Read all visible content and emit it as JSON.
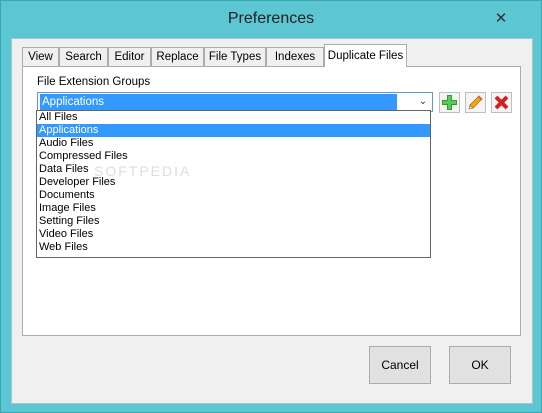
{
  "window": {
    "title": "Preferences",
    "close_glyph": "✕"
  },
  "tabs": [
    {
      "label": "View"
    },
    {
      "label": "Search"
    },
    {
      "label": "Editor"
    },
    {
      "label": "Replace"
    },
    {
      "label": "File Types"
    },
    {
      "label": "Indexes"
    },
    {
      "label": "Duplicate Files",
      "active": true
    }
  ],
  "panel": {
    "group_label": "File Extension Groups",
    "selected_group": "Applications",
    "dropdown_arrow": "⌄",
    "buttons": {
      "add_icon": "plus-icon",
      "edit_icon": "pencil-icon",
      "delete_icon": "delete-x-icon"
    },
    "colors": {
      "add": "#2e9e2e",
      "edit": "#f2a51a",
      "delete": "#d32020",
      "selection": "#3399ff"
    }
  },
  "dropdown_items": [
    {
      "label": "All Files"
    },
    {
      "label": "Applications",
      "selected": true
    },
    {
      "label": "Audio Files"
    },
    {
      "label": "Compressed Files"
    },
    {
      "label": "Data Files"
    },
    {
      "label": "Developer Files"
    },
    {
      "label": "Documents"
    },
    {
      "label": "Image Files"
    },
    {
      "label": "Setting Files"
    },
    {
      "label": "Video Files"
    },
    {
      "label": "Web Files"
    }
  ],
  "watermark": "SOFTPEDIA",
  "footer": {
    "cancel_label": "Cancel",
    "ok_label": "OK"
  }
}
